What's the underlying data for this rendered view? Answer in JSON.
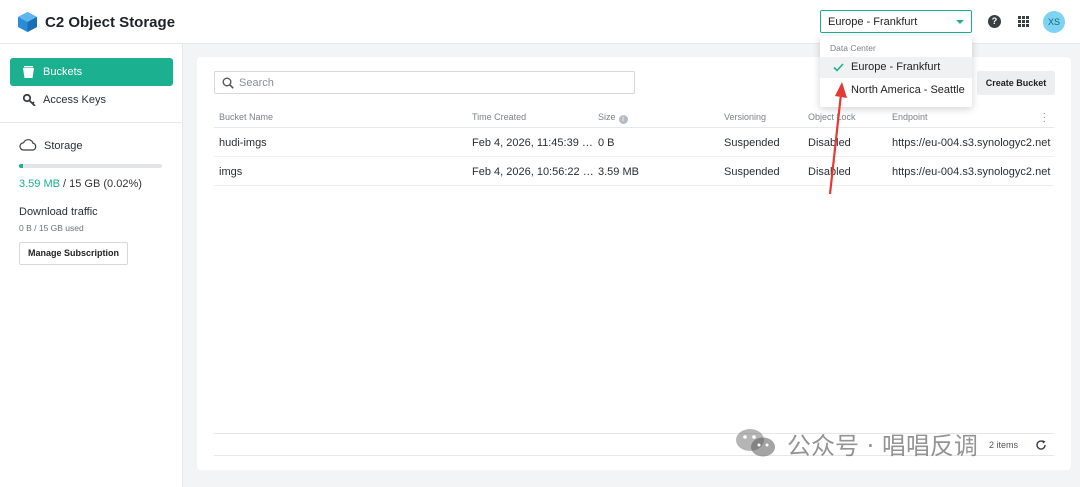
{
  "app": {
    "title": "C2 Object Storage"
  },
  "header": {
    "datacenter_selected": "Europe - Frankfurt",
    "avatar_initials": "XS",
    "help_glyph": "?"
  },
  "sidebar": {
    "nav": [
      {
        "label": "Buckets",
        "icon": "bucket-icon",
        "active": true
      },
      {
        "label": "Access Keys",
        "icon": "key-icon",
        "active": false
      }
    ],
    "storage": {
      "label": "Storage",
      "used_fraction": 0.0002,
      "used": "3.59 MB",
      "total": " / 15 GB (0.02%)"
    },
    "download": {
      "label": "Download traffic",
      "used": "0 B / 15 GB used"
    },
    "manage_button": "Manage Subscription"
  },
  "main": {
    "search_placeholder": "Search",
    "create_button": "Create Bucket",
    "columns": [
      "Bucket Name",
      "Time Created",
      "Size",
      "Versioning",
      "Object Lock",
      "Endpoint"
    ],
    "rows": [
      {
        "name": "hudi-imgs",
        "time": "Feb 4, 2026, 11:45:39 …",
        "size": "0 B",
        "versioning": "Suspended",
        "object_lock": "Disabled",
        "endpoint": "https://eu-004.s3.synologyc2.net"
      },
      {
        "name": "imgs",
        "time": "Feb 4, 2026, 10:56:22 …",
        "size": "3.59 MB",
        "versioning": "Suspended",
        "object_lock": "Disabled",
        "endpoint": "https://eu-004.s3.synologyc2.net"
      }
    ],
    "items_count": "2 items"
  },
  "dropdown": {
    "header": "Data Center",
    "options": [
      {
        "label": "Europe - Frankfurt",
        "selected": true
      },
      {
        "label": "North America - Seattle",
        "selected": false
      }
    ]
  },
  "watermark": {
    "text": "公众号 · 唱唱反调"
  },
  "colors": {
    "accent": "#1bb08f",
    "annotation": "#e53935"
  }
}
